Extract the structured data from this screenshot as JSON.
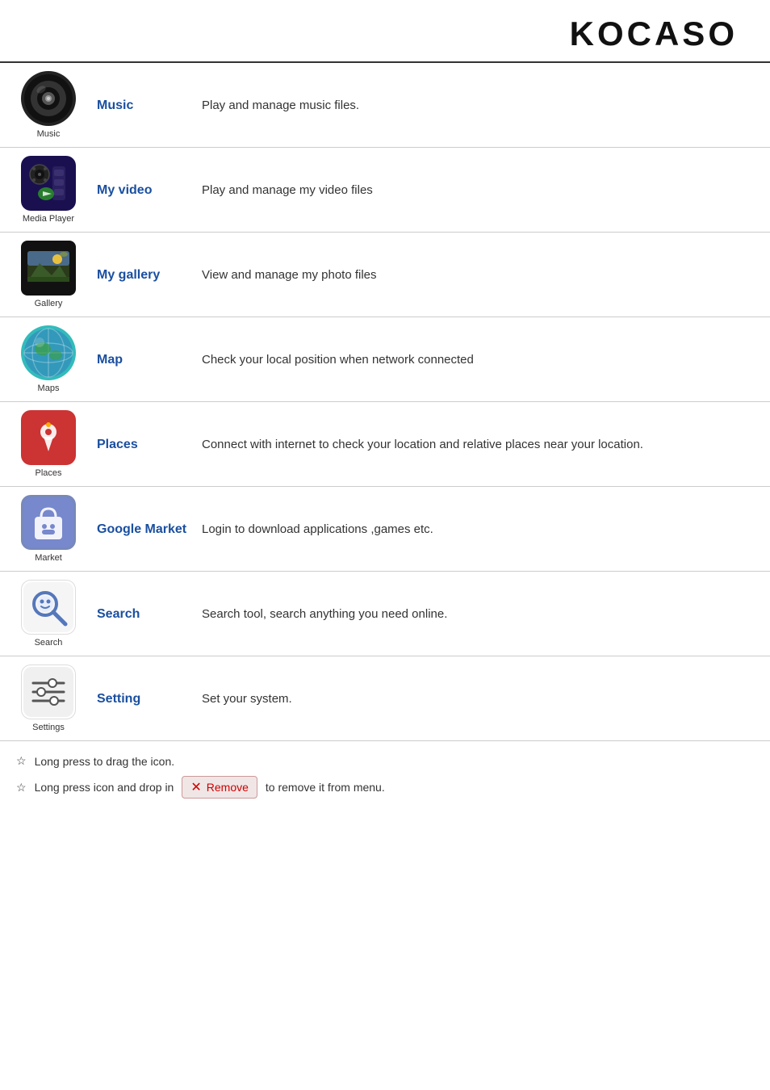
{
  "header": {
    "logo": "KOCASO"
  },
  "apps": [
    {
      "id": "music",
      "name": "Music",
      "label": "Music",
      "desc": "Play and manage music files.",
      "icon_type": "music"
    },
    {
      "id": "my-video",
      "name": "My video",
      "label": "Media Player",
      "desc": "Play and manage my video files",
      "icon_type": "video"
    },
    {
      "id": "my-gallery",
      "name": "My gallery",
      "label": "Gallery",
      "desc": "View and manage my photo files",
      "icon_type": "gallery"
    },
    {
      "id": "map",
      "name": "Map",
      "label": "Maps",
      "desc": "Check your local position when network connected",
      "icon_type": "maps"
    },
    {
      "id": "places",
      "name": "Places",
      "label": "Places",
      "desc": "Connect with internet to check your location and relative places near your location.",
      "icon_type": "places"
    },
    {
      "id": "google-market",
      "name": "Google Market",
      "label": "Market",
      "desc": "Login to download applications ,games etc.",
      "icon_type": "market"
    },
    {
      "id": "search",
      "name": "Search",
      "label": "Search",
      "desc": "Search tool, search anything you need online.",
      "icon_type": "search"
    },
    {
      "id": "setting",
      "name": "Setting",
      "label": "Settings",
      "desc": "Set your system.",
      "icon_type": "settings"
    }
  ],
  "footer": {
    "note1": "Long press to drag the icon.",
    "note2_pre": "Long press icon and drop in",
    "note2_post": "to remove it from menu.",
    "remove_label": "Remove",
    "star": "☆"
  }
}
